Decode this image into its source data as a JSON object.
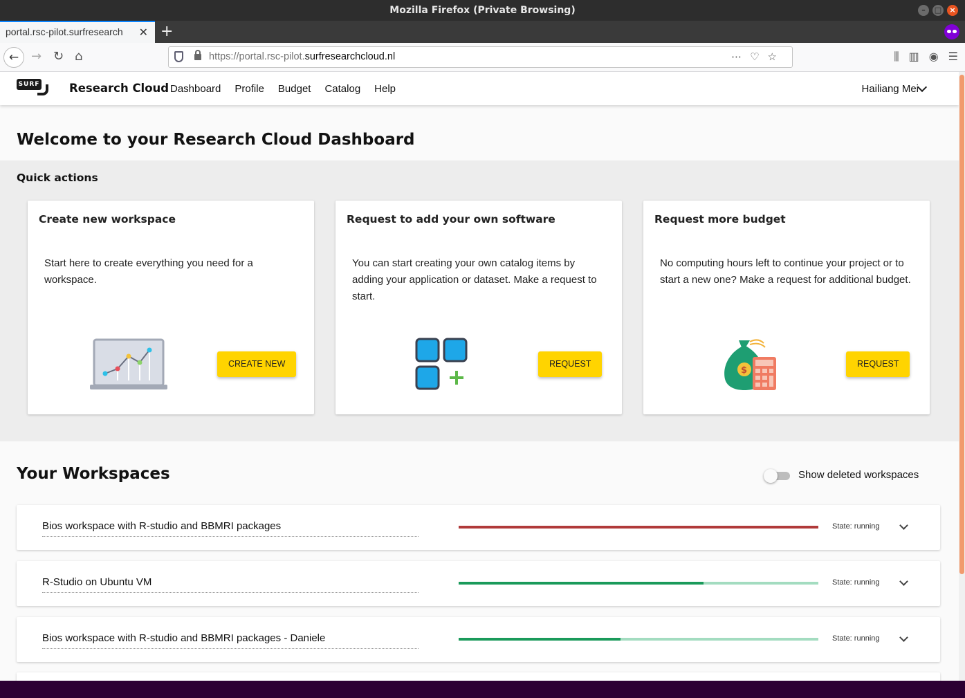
{
  "browser": {
    "window_title": "Mozilla Firefox (Private Browsing)",
    "tab_title": "portal.rsc-pilot.surfresearch",
    "url_prefix": "https://portal.rsc-pilot.",
    "url_domain": "surfresearchcloud.nl",
    "window_buttons": [
      "–",
      "□",
      "×"
    ]
  },
  "header": {
    "logo_text": "SURF",
    "brand": "Research Cloud",
    "menu": [
      "Dashboard",
      "Profile",
      "Budget",
      "Catalog",
      "Help"
    ],
    "user": "Hailiang Mei"
  },
  "welcome": "Welcome to your Research Cloud Dashboard",
  "quick_actions": {
    "title": "Quick actions",
    "cards": [
      {
        "title": "Create new workspace",
        "text": "Start here to create everything you need for a workspace.",
        "button": "CREATE NEW",
        "illustration": "laptop-chart-icon"
      },
      {
        "title": "Request to add your own software",
        "text": "You can start creating your own catalog items by adding your application or dataset. Make a request to start.",
        "button": "REQUEST",
        "illustration": "apps-add-icon"
      },
      {
        "title": "Request more budget",
        "text": "No computing hours left to continue your project or to start a new one? Make a request for additional budget.",
        "button": "REQUEST",
        "illustration": "money-bag-calculator-icon"
      }
    ]
  },
  "workspaces": {
    "title": "Your Workspaces",
    "toggle_label": "Show deleted workspaces",
    "toggle_on": false,
    "items": [
      {
        "name": "Bios workspace with R-studio and BBMRI packages",
        "state": "State: running",
        "progress": 1.0,
        "bar_status": "error"
      },
      {
        "name": "R-Studio on Ubuntu VM",
        "state": "State: running",
        "progress": 0.68,
        "bar_status": "ok"
      },
      {
        "name": "Bios workspace with R-studio and BBMRI packages - Daniele",
        "state": "State: running",
        "progress": 0.45,
        "bar_status": "ok"
      }
    ]
  },
  "colors": {
    "accent_button": "#ffd400",
    "bar_ok": "#1a9a5a",
    "bar_ok_track": "#a3dcc0",
    "bar_error": "#b03a3a"
  }
}
